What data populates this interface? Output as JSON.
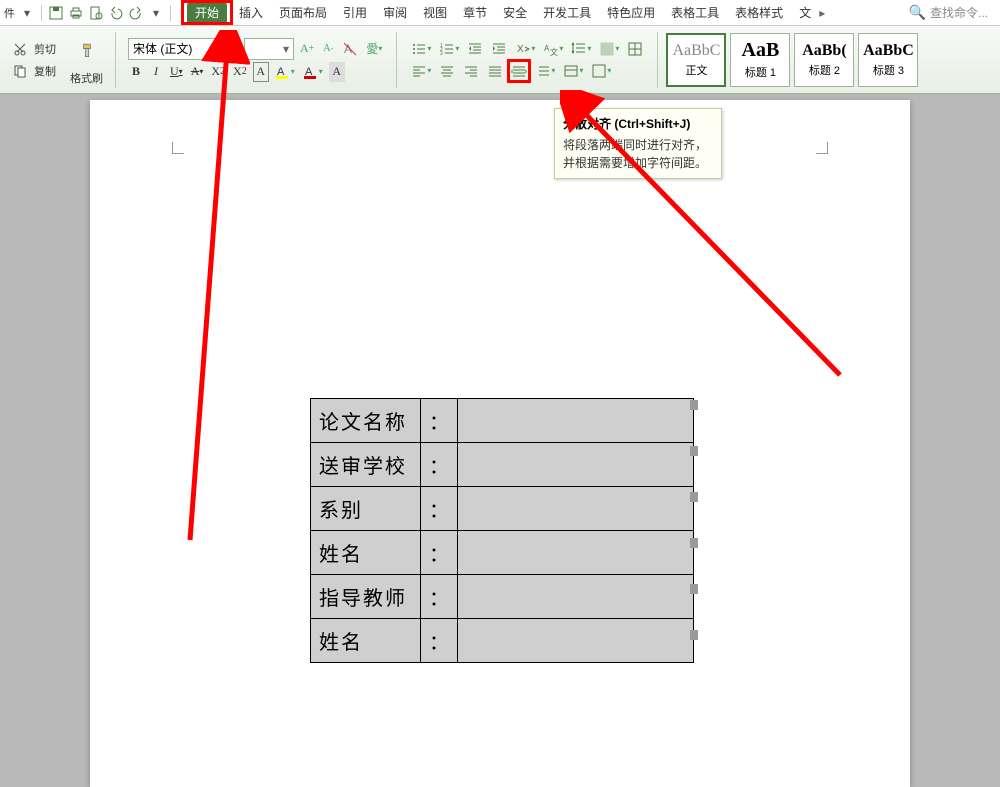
{
  "qat": {
    "file_suffix": "件"
  },
  "tabs": {
    "start": "开始",
    "insert": "插入",
    "layout": "页面布局",
    "references": "引用",
    "review": "审阅",
    "view": "视图",
    "sections": "章节",
    "security": "安全",
    "dev": "开发工具",
    "special": "特色应用",
    "tabletools": "表格工具",
    "tablestyle": "表格样式",
    "text_cut": "文"
  },
  "search": {
    "placeholder": "查找命令..."
  },
  "clipboard": {
    "cut": "剪切",
    "copy": "复制",
    "formatpainter": "格式刷"
  },
  "font": {
    "name": "宋体 (正文)",
    "size": ""
  },
  "styles": {
    "s1": {
      "sample": "AaBbC",
      "label": "正文"
    },
    "s2": {
      "sample": "AaB",
      "label": "标题 1"
    },
    "s3": {
      "sample": "AaBb(",
      "label": "标题 2"
    },
    "s4": {
      "sample": "AaBbC",
      "label": "标题 3"
    }
  },
  "tooltip": {
    "title": "分散对齐 (Ctrl+Shift+J)",
    "body": "将段落两端同时进行对齐，并根据需要增加字符间距。"
  },
  "table": {
    "r1": "论文名称",
    "r2": "送审学校",
    "r3": "系别",
    "r4": "姓名",
    "r5": "指导教师",
    "r6": "姓名",
    "colon": "："
  }
}
